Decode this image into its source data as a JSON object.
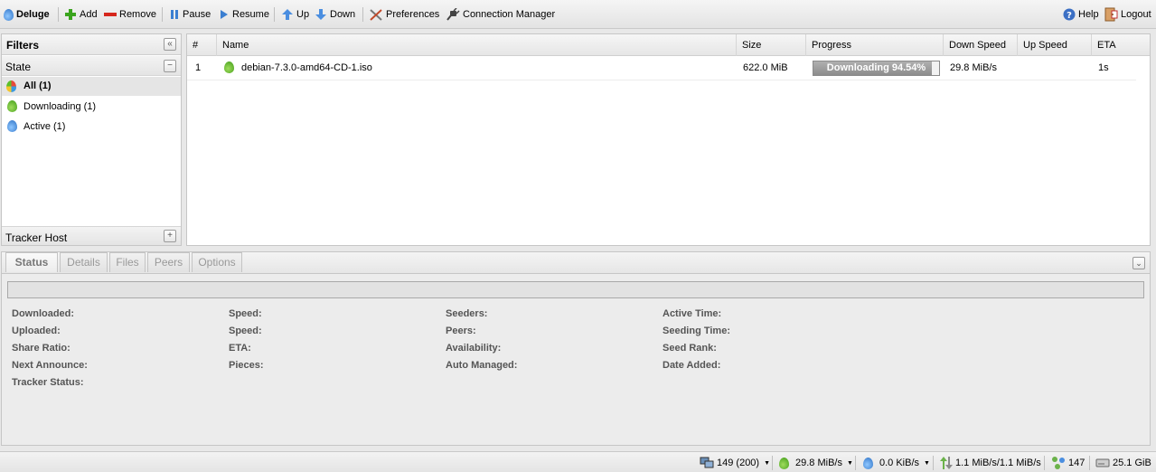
{
  "toolbar": {
    "brand": "Deluge",
    "add": "Add",
    "remove": "Remove",
    "pause": "Pause",
    "resume": "Resume",
    "up": "Up",
    "down": "Down",
    "preferences": "Preferences",
    "connection_manager": "Connection Manager",
    "help": "Help",
    "logout": "Logout"
  },
  "filters": {
    "title": "Filters",
    "state_header": "State",
    "items": [
      {
        "label": "All (1)",
        "icon": "all-state-icon"
      },
      {
        "label": "Downloading (1)",
        "icon": "downloading-icon"
      },
      {
        "label": "Active (1)",
        "icon": "active-icon"
      }
    ],
    "tracker_header": "Tracker Host"
  },
  "grid": {
    "columns": [
      "#",
      "Name",
      "Size",
      "Progress",
      "Down Speed",
      "Up Speed",
      "ETA"
    ],
    "rows": [
      {
        "num": "1",
        "name": "debian-7.3.0-amd64-CD-1.iso",
        "size": "622.0 MiB",
        "progress_text": "Downloading 94.54%",
        "progress": 0.9454,
        "down_speed": "29.8 MiB/s",
        "up_speed": "",
        "eta": "1s"
      }
    ]
  },
  "details": {
    "tabs": [
      "Status",
      "Details",
      "Files",
      "Peers",
      "Options"
    ],
    "active_tab": "Status",
    "labels": {
      "col1": [
        "Downloaded:",
        "Uploaded:",
        "Share Ratio:",
        "Next Announce:",
        "Tracker Status:"
      ],
      "col2": [
        "Speed:",
        "Speed:",
        "ETA:",
        "Pieces:"
      ],
      "col3": [
        "Seeders:",
        "Peers:",
        "Availability:",
        "Auto Managed:"
      ],
      "col4": [
        "Active Time:",
        "Seeding Time:",
        "Seed Rank:",
        "Date Added:"
      ]
    }
  },
  "statusbar": {
    "connections": "149 (200)",
    "down": "29.8 MiB/s",
    "up": "0.0 KiB/s",
    "traffic": "1.1 MiB/s/1.1 MiB/s",
    "dht": "147",
    "free_space": "25.1 GiB"
  },
  "colors": {
    "accent_green": "#3d9a17",
    "accent_blue": "#2a6fc4",
    "progress_fill": "#8e8e8e"
  }
}
